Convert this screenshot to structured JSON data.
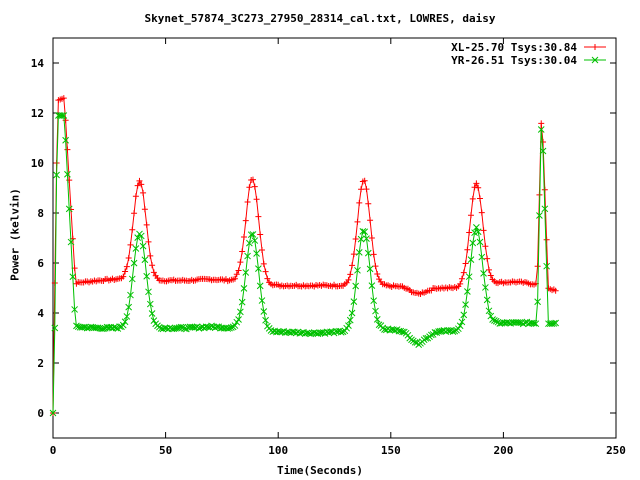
{
  "chart_data": {
    "type": "line",
    "title": "Skynet_57874_3C273_27950_28314_cal.txt, LOWRES, daisy",
    "xlabel": "Time(Seconds)",
    "ylabel": "Power (kelvin)",
    "xlim": [
      0,
      250
    ],
    "ylim": [
      -1,
      15
    ],
    "xticks": [
      0,
      50,
      100,
      150,
      200,
      250
    ],
    "yticks": [
      0,
      2,
      4,
      6,
      8,
      10,
      12,
      14
    ],
    "grid": false,
    "legend_position": "top-right",
    "series": [
      {
        "name": "XL-25.70 Tsys:30.84",
        "color": "#ff0000",
        "marker": "plus",
        "baseline_segments": [
          {
            "x": [
              0,
              2,
              5,
              10,
              20,
              28
            ],
            "y": [
              0,
              12.5,
              12.6,
              5.2,
              5.3,
              5.35
            ]
          },
          {
            "x": [
              45,
              60,
              70,
              80,
              82
            ],
            "y": [
              5.3,
              5.3,
              5.35,
              5.3,
              5.3
            ]
          },
          {
            "x": [
              95,
              100,
              115,
              130
            ],
            "y": [
              5.15,
              5.1,
              5.1,
              5.1
            ]
          },
          {
            "x": [
              145,
              155,
              162,
              170,
              180
            ],
            "y": [
              5.1,
              5.05,
              4.75,
              5.0,
              5.0
            ]
          },
          {
            "x": [
              195,
              205,
              215,
              217,
              220,
              224
            ],
            "y": [
              5.2,
              5.25,
              5.15,
              12.3,
              5.0,
              4.85
            ]
          }
        ],
        "peaks": [
          {
            "x": 38.5,
            "y": 9.3
          },
          {
            "x": 88.5,
            "y": 9.4
          },
          {
            "x": 138,
            "y": 9.3
          },
          {
            "x": 188,
            "y": 9.2
          }
        ]
      },
      {
        "name": "YR-26.51 Tsys:30.04",
        "color": "#00c000",
        "marker": "cross",
        "baseline_segments": [
          {
            "x": [
              0,
              2,
              5,
              10,
              20,
              28
            ],
            "y": [
              0,
              11.9,
              11.9,
              3.45,
              3.4,
              3.4
            ]
          },
          {
            "x": [
              45,
              60,
              70,
              80,
              82
            ],
            "y": [
              3.4,
              3.4,
              3.45,
              3.4,
              3.4
            ]
          },
          {
            "x": [
              95,
              100,
              115,
              130
            ],
            "y": [
              3.25,
              3.25,
              3.2,
              3.25
            ]
          },
          {
            "x": [
              145,
              155,
              162,
              170,
              180
            ],
            "y": [
              3.35,
              3.3,
              2.75,
              3.25,
              3.3
            ]
          },
          {
            "x": [
              195,
              205,
              215,
              217,
              220,
              224
            ],
            "y": [
              3.6,
              3.6,
              3.6,
              12.2,
              3.6,
              3.6
            ]
          }
        ],
        "peaks": [
          {
            "x": 38.5,
            "y": 7.2
          },
          {
            "x": 88.5,
            "y": 7.2
          },
          {
            "x": 138,
            "y": 7.3
          },
          {
            "x": 188,
            "y": 7.4
          }
        ]
      }
    ]
  }
}
